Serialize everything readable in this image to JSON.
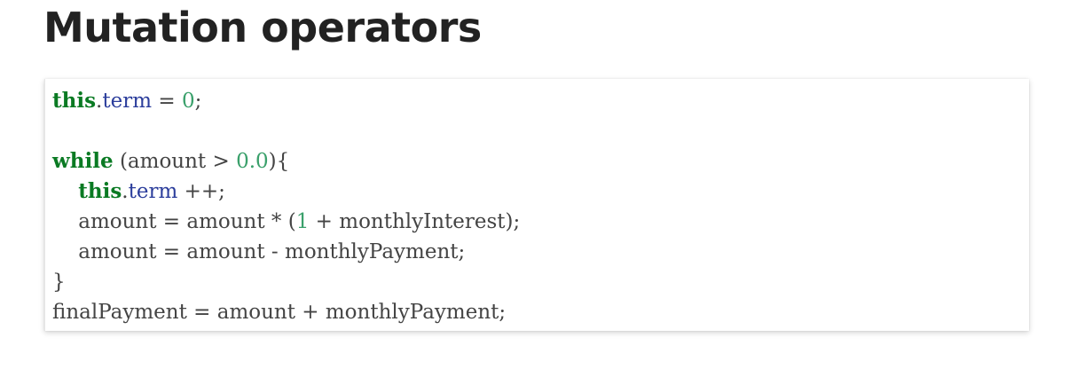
{
  "title": "Mutation operators",
  "code_lines": [
    [
      {
        "t": "this",
        "k": "kw"
      },
      {
        "t": ".",
        "k": "plain"
      },
      {
        "t": "term",
        "k": "field"
      },
      {
        "t": " = ",
        "k": "op"
      },
      {
        "t": "0",
        "k": "num"
      },
      {
        "t": ";",
        "k": "plain"
      }
    ],
    [],
    [
      {
        "t": "while",
        "k": "kw"
      },
      {
        "t": " (amount > ",
        "k": "plain"
      },
      {
        "t": "0.0",
        "k": "num"
      },
      {
        "t": "){",
        "k": "plain"
      }
    ],
    [
      {
        "t": "    ",
        "k": "plain"
      },
      {
        "t": "this",
        "k": "kw"
      },
      {
        "t": ".",
        "k": "plain"
      },
      {
        "t": "term",
        "k": "field"
      },
      {
        "t": " ++;",
        "k": "plain"
      }
    ],
    [
      {
        "t": "    amount = amount * (",
        "k": "plain"
      },
      {
        "t": "1",
        "k": "num"
      },
      {
        "t": " + monthlyInterest);",
        "k": "plain"
      }
    ],
    [
      {
        "t": "    amount = amount - monthlyPayment;",
        "k": "plain"
      }
    ],
    [
      {
        "t": "}",
        "k": "plain"
      }
    ],
    [
      {
        "t": "finalPayment = amount + monthlyPayment;",
        "k": "plain"
      }
    ]
  ]
}
